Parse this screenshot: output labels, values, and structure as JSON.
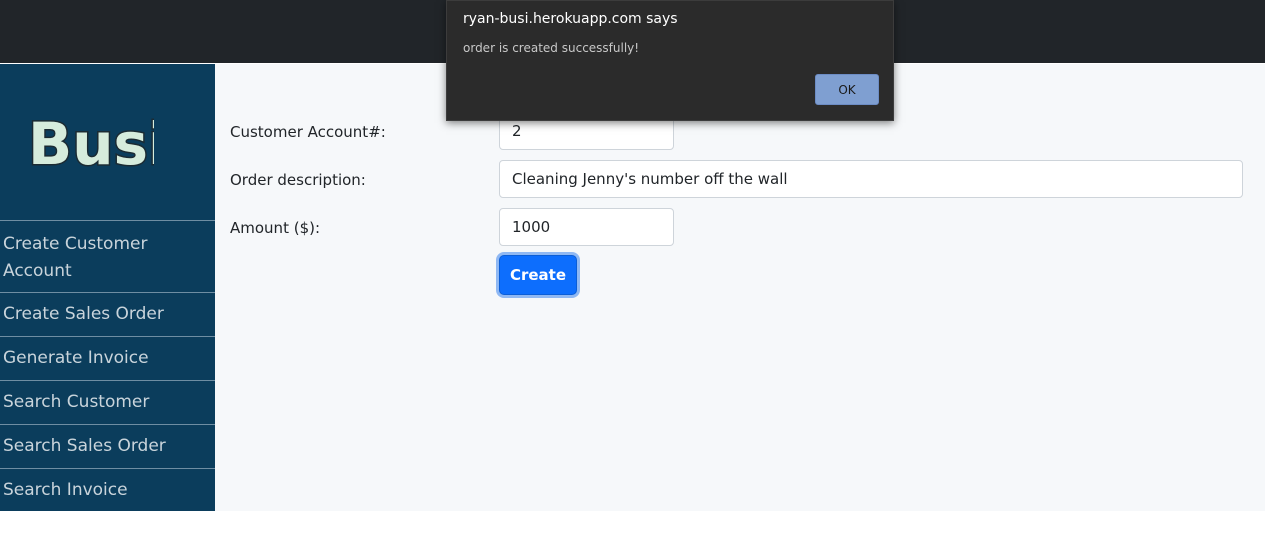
{
  "dialog": {
    "title": "ryan-busi.herokuapp.com says",
    "message": "order is created successfully!",
    "ok_label": "OK"
  },
  "sidebar": {
    "logo_text": "Busi",
    "items": [
      {
        "label": "Create Customer Account"
      },
      {
        "label": "Create Sales Order"
      },
      {
        "label": "Generate Invoice"
      },
      {
        "label": "Search Customer"
      },
      {
        "label": "Search Sales Order"
      },
      {
        "label": "Search Invoice"
      }
    ]
  },
  "form": {
    "account_label": "Customer Account#:",
    "account_value": "2",
    "description_label": "Order description:",
    "description_value": "Cleaning Jenny's number off the wall",
    "amount_label": "Amount ($):",
    "amount_value": "1000",
    "create_label": "Create"
  },
  "colors": {
    "topbar": "#212529",
    "sidebar": "#0b3d5c",
    "primary": "#0d6efd",
    "logo_fill": "#d6ecdc"
  }
}
